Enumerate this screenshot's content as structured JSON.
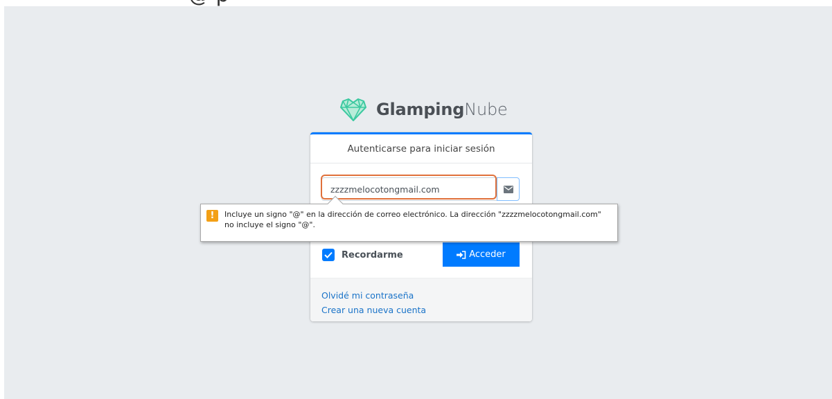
{
  "top_glyph": "@ p",
  "brand": {
    "name_bold": "Glamping",
    "name_light": "Nube",
    "logo_icon": "heart-gem-logo",
    "logo_color": "#3cc9a0"
  },
  "login_card": {
    "header": "Autenticarse para iniciar sesión",
    "email": {
      "value": "zzzzmelocotongmail.com",
      "addon_icon": "envelope-icon"
    },
    "remember": {
      "label": "Recordarme",
      "checked": true
    },
    "login_button": {
      "label": "Acceder",
      "icon": "sign-in-icon"
    },
    "links": {
      "forgot_password": "Olvidé mi contraseña",
      "register": "Crear una nueva cuenta"
    }
  },
  "validation_tooltip": {
    "icon": "warning-icon",
    "message": "Incluye un signo \"@\" en la dirección de correo electrónico. La dirección \"zzzzmelocotongmail.com\" no incluye el signo \"@\"."
  },
  "colors": {
    "primary": "#007bff",
    "background": "#e9ecef",
    "focus_ring": "#e0703a",
    "warning": "#f3a016"
  }
}
